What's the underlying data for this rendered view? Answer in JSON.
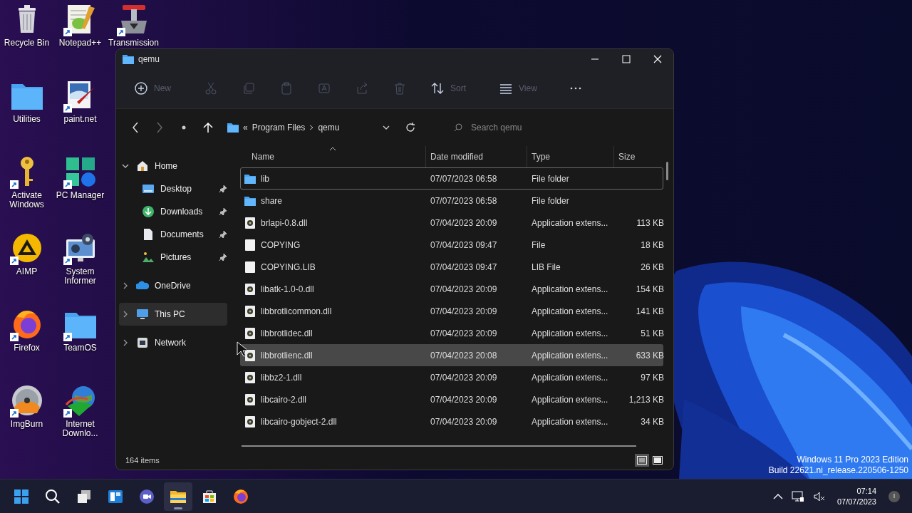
{
  "desktop_icons": [
    {
      "label": "Recycle Bin",
      "kind": "bin",
      "shortcut": false
    },
    {
      "label": "Utilities",
      "kind": "folder",
      "shortcut": false
    },
    {
      "label": "Activate Windows",
      "kind": "key",
      "shortcut": true
    },
    {
      "label": "AIMP",
      "kind": "aimp",
      "shortcut": true
    },
    {
      "label": "Firefox",
      "kind": "firefox",
      "shortcut": true
    },
    {
      "label": "ImgBurn",
      "kind": "disc",
      "shortcut": true
    },
    {
      "label": "Notepad++",
      "kind": "notepad",
      "shortcut": true
    },
    {
      "label": "paint.net",
      "kind": "paint",
      "shortcut": true
    },
    {
      "label": "PC Manager",
      "kind": "pcmanager",
      "shortcut": true
    },
    {
      "label": "System Informer",
      "kind": "sysinfo",
      "shortcut": true
    },
    {
      "label": "TeamOS",
      "kind": "folder",
      "shortcut": true
    },
    {
      "label": "Internet Downlo...",
      "kind": "download",
      "shortcut": true
    },
    {
      "label": "Transmission",
      "kind": "transmission",
      "shortcut": true
    }
  ],
  "window": {
    "title": "qemu",
    "toolbar": [
      {
        "kind": "new",
        "label": "New",
        "disabled": false
      },
      {
        "kind": "cut",
        "disabled": true
      },
      {
        "kind": "copy",
        "disabled": true
      },
      {
        "kind": "paste",
        "disabled": true
      },
      {
        "kind": "rename",
        "disabled": true
      },
      {
        "kind": "share",
        "disabled": true
      },
      {
        "kind": "delete",
        "disabled": true
      },
      {
        "kind": "sort",
        "label": "Sort",
        "disabled": false
      },
      {
        "kind": "view",
        "label": "View",
        "disabled": false
      },
      {
        "kind": "more",
        "disabled": false
      }
    ],
    "address": {
      "overflow": "«",
      "crumbs": [
        "Program Files",
        "qemu"
      ]
    },
    "search": {
      "placeholder": "Search qemu"
    },
    "nav": [
      {
        "label": "Home",
        "kind": "home",
        "expanded": true,
        "selected": false,
        "children": [
          {
            "label": "Desktop",
            "kind": "desktop",
            "pinned": true,
            "selected": false
          },
          {
            "label": "Downloads",
            "kind": "downloads",
            "pinned": true,
            "selected": false
          },
          {
            "label": "Documents",
            "kind": "documents",
            "pinned": true,
            "selected": false
          },
          {
            "label": "Pictures",
            "kind": "pictures",
            "pinned": true,
            "selected": false
          }
        ]
      },
      {
        "label": "OneDrive",
        "kind": "cloud",
        "expanded": false,
        "selected": false
      },
      {
        "label": "This PC",
        "kind": "pc",
        "expanded": false,
        "selected": true
      },
      {
        "label": "Network",
        "kind": "network",
        "expanded": false,
        "selected": false
      }
    ],
    "columns": [
      {
        "label": "Name",
        "sorted": true
      },
      {
        "label": "Date modified",
        "sorted": false
      },
      {
        "label": "Type",
        "sorted": false
      },
      {
        "label": "Size",
        "sorted": false
      }
    ],
    "rows": [
      {
        "name": "lib",
        "date": "07/07/2023 06:58",
        "type": "File folder",
        "kind": "folder",
        "focused": true,
        "selected": false
      },
      {
        "name": "share",
        "date": "07/07/2023 06:58",
        "type": "File folder",
        "kind": "folder",
        "focused": false,
        "selected": false
      },
      {
        "name": "brlapi-0.8.dll",
        "date": "07/04/2023 20:09",
        "type": "Application extens...",
        "size": "113 KB",
        "kind": "dll",
        "focused": false,
        "selected": false
      },
      {
        "name": "COPYING",
        "date": "07/04/2023 09:47",
        "type": "File",
        "size": "18 KB",
        "kind": "file",
        "focused": false,
        "selected": false
      },
      {
        "name": "COPYING.LIB",
        "date": "07/04/2023 09:47",
        "type": "LIB File",
        "size": "26 KB",
        "kind": "file",
        "focused": false,
        "selected": false
      },
      {
        "name": "libatk-1.0-0.dll",
        "date": "07/04/2023 20:09",
        "type": "Application extens...",
        "size": "154 KB",
        "kind": "dll",
        "focused": false,
        "selected": false
      },
      {
        "name": "libbrotlicommon.dll",
        "date": "07/04/2023 20:09",
        "type": "Application extens...",
        "size": "141 KB",
        "kind": "dll",
        "focused": false,
        "selected": false
      },
      {
        "name": "libbrotlidec.dll",
        "date": "07/04/2023 20:09",
        "type": "Application extens...",
        "size": "51 KB",
        "kind": "dll",
        "focused": false,
        "selected": false
      },
      {
        "name": "libbrotlienc.dll",
        "date": "07/04/2023 20:08",
        "type": "Application extens...",
        "size": "633 KB",
        "kind": "dll",
        "focused": false,
        "selected": true
      },
      {
        "name": "libbz2-1.dll",
        "date": "07/04/2023 20:09",
        "type": "Application extens...",
        "size": "97 KB",
        "kind": "dll",
        "focused": false,
        "selected": false
      },
      {
        "name": "libcairo-2.dll",
        "date": "07/04/2023 20:09",
        "type": "Application extens...",
        "size": "1,213 KB",
        "kind": "dll",
        "focused": false,
        "selected": false
      },
      {
        "name": "libcairo-gobject-2.dll",
        "date": "07/04/2023 20:09",
        "type": "Application extens...",
        "size": "34 KB",
        "kind": "dll",
        "focused": false,
        "selected": false
      }
    ],
    "status": "164 items",
    "views": [
      {
        "kind": "details",
        "selected": true
      },
      {
        "kind": "tiles",
        "selected": false
      }
    ]
  },
  "edition": {
    "line1": "Windows 11 Pro 2023 Edition",
    "line2": "Build 22621.ni_release.220506-1250"
  },
  "taskbar": {
    "apps": [
      {
        "kind": "start",
        "active": false
      },
      {
        "kind": "search",
        "active": false
      },
      {
        "kind": "taskview",
        "active": false
      },
      {
        "kind": "widgets",
        "active": false
      },
      {
        "kind": "chat",
        "active": false
      },
      {
        "kind": "explorer",
        "active": true
      },
      {
        "kind": "store",
        "active": false
      },
      {
        "kind": "firefox",
        "active": false
      }
    ],
    "time": "07:14",
    "date": "07/07/2023"
  }
}
